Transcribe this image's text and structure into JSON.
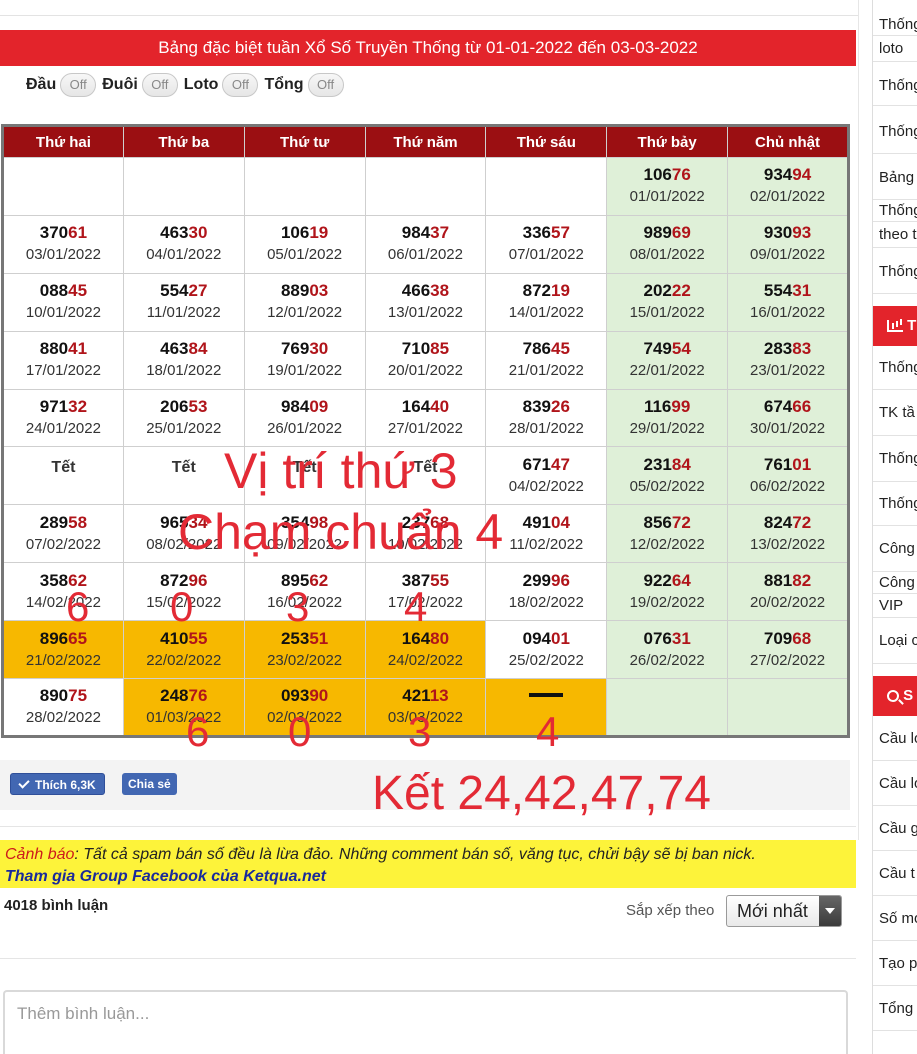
{
  "title": "Bảng đặc biệt tuần Xổ Số Truyền Thống từ 01-01-2022 đến 03-03-2022",
  "toggles": [
    {
      "label": "Đầu",
      "state": "Off"
    },
    {
      "label": "Đuôi",
      "state": "Off"
    },
    {
      "label": "Loto",
      "state": "Off"
    },
    {
      "label": "Tổng",
      "state": "Off"
    }
  ],
  "weekdays": [
    "Thứ hai",
    "Thứ ba",
    "Thứ tư",
    "Thứ năm",
    "Thứ sáu",
    "Thứ bảy",
    "Chủ nhật"
  ],
  "colors": {
    "title_bg": "#e3242b",
    "header_bg": "#9b0f12",
    "weekend_bg": "#dff0d8",
    "highlight_bg": "#f7b800",
    "tail_color": "#b0141a",
    "annotation": "#e32a35"
  },
  "weeks": [
    [
      {
        "empty": true
      },
      {
        "empty": true
      },
      {
        "empty": true
      },
      {
        "empty": true
      },
      {
        "empty": true
      },
      {
        "head": "106",
        "tail": "76",
        "date": "01/01/2022"
      },
      {
        "head": "934",
        "tail": "94",
        "date": "02/01/2022"
      }
    ],
    [
      {
        "head": "370",
        "tail": "61",
        "date": "03/01/2022"
      },
      {
        "head": "463",
        "tail": "30",
        "date": "04/01/2022"
      },
      {
        "head": "106",
        "tail": "19",
        "date": "05/01/2022"
      },
      {
        "head": "984",
        "tail": "37",
        "date": "06/01/2022"
      },
      {
        "head": "336",
        "tail": "57",
        "date": "07/01/2022"
      },
      {
        "head": "989",
        "tail": "69",
        "date": "08/01/2022"
      },
      {
        "head": "930",
        "tail": "93",
        "date": "09/01/2022"
      }
    ],
    [
      {
        "head": "088",
        "tail": "45",
        "date": "10/01/2022"
      },
      {
        "head": "554",
        "tail": "27",
        "date": "11/01/2022"
      },
      {
        "head": "889",
        "tail": "03",
        "date": "12/01/2022"
      },
      {
        "head": "466",
        "tail": "38",
        "date": "13/01/2022"
      },
      {
        "head": "872",
        "tail": "19",
        "date": "14/01/2022"
      },
      {
        "head": "202",
        "tail": "22",
        "date": "15/01/2022"
      },
      {
        "head": "554",
        "tail": "31",
        "date": "16/01/2022"
      }
    ],
    [
      {
        "head": "880",
        "tail": "41",
        "date": "17/01/2022"
      },
      {
        "head": "463",
        "tail": "84",
        "date": "18/01/2022"
      },
      {
        "head": "769",
        "tail": "30",
        "date": "19/01/2022"
      },
      {
        "head": "710",
        "tail": "85",
        "date": "20/01/2022"
      },
      {
        "head": "786",
        "tail": "45",
        "date": "21/01/2022"
      },
      {
        "head": "749",
        "tail": "54",
        "date": "22/01/2022"
      },
      {
        "head": "283",
        "tail": "83",
        "date": "23/01/2022"
      }
    ],
    [
      {
        "head": "971",
        "tail": "32",
        "date": "24/01/2022"
      },
      {
        "head": "206",
        "tail": "53",
        "date": "25/01/2022"
      },
      {
        "head": "984",
        "tail": "09",
        "date": "26/01/2022"
      },
      {
        "head": "164",
        "tail": "40",
        "date": "27/01/2022"
      },
      {
        "head": "839",
        "tail": "26",
        "date": "28/01/2022"
      },
      {
        "head": "116",
        "tail": "99",
        "date": "29/01/2022"
      },
      {
        "head": "674",
        "tail": "66",
        "date": "30/01/2022"
      }
    ],
    [
      {
        "tet": "Tết"
      },
      {
        "tet": "Tết"
      },
      {
        "tet": "Tết"
      },
      {
        "tet": "Tết"
      },
      {
        "head": "671",
        "tail": "47",
        "date": "04/02/2022"
      },
      {
        "head": "231",
        "tail": "84",
        "date": "05/02/2022"
      },
      {
        "head": "761",
        "tail": "01",
        "date": "06/02/2022"
      }
    ],
    [
      {
        "head": "289",
        "tail": "58",
        "date": "07/02/2022"
      },
      {
        "head": "965",
        "tail": "34",
        "date": "08/02/2022"
      },
      {
        "head": "354",
        "tail": "98",
        "date": "09/02/2022"
      },
      {
        "head": "237",
        "tail": "68",
        "date": "10/02/2022"
      },
      {
        "head": "491",
        "tail": "04",
        "date": "11/02/2022"
      },
      {
        "head": "856",
        "tail": "72",
        "date": "12/02/2022"
      },
      {
        "head": "824",
        "tail": "72",
        "date": "13/02/2022"
      }
    ],
    [
      {
        "head": "358",
        "tail": "62",
        "date": "14/02/2022"
      },
      {
        "head": "872",
        "tail": "96",
        "date": "15/02/2022"
      },
      {
        "head": "895",
        "tail": "62",
        "date": "16/02/2022"
      },
      {
        "head": "387",
        "tail": "55",
        "date": "17/02/2022"
      },
      {
        "head": "299",
        "tail": "96",
        "date": "18/02/2022"
      },
      {
        "head": "922",
        "tail": "64",
        "date": "19/02/2022"
      },
      {
        "head": "881",
        "tail": "82",
        "date": "20/02/2022"
      }
    ],
    [
      {
        "head": "896",
        "tail": "65",
        "date": "21/02/2022",
        "highlight": true
      },
      {
        "head": "410",
        "tail": "55",
        "date": "22/02/2022",
        "highlight": true
      },
      {
        "head": "253",
        "tail": "51",
        "date": "23/02/2022",
        "highlight": true
      },
      {
        "head": "164",
        "tail": "80",
        "date": "24/02/2022",
        "highlight": true
      },
      {
        "head": "094",
        "tail": "01",
        "date": "25/02/2022"
      },
      {
        "head": "076",
        "tail": "31",
        "date": "26/02/2022"
      },
      {
        "head": "709",
        "tail": "68",
        "date": "27/02/2022"
      }
    ],
    [
      {
        "head": "890",
        "tail": "75",
        "date": "28/02/2022"
      },
      {
        "head": "248",
        "tail": "76",
        "date": "01/03/2022",
        "highlight": true
      },
      {
        "head": "093",
        "tail": "90",
        "date": "02/03/2022",
        "highlight": true
      },
      {
        "head": "421",
        "tail": "13",
        "date": "03/03/2022",
        "highlight": true
      },
      {
        "pending": true,
        "highlight": true
      },
      {
        "empty": true
      },
      {
        "empty": true
      }
    ]
  ],
  "annotations": {
    "line1": "Vị trí thứ 3",
    "line2": "Chạm chuẩn 4",
    "row_digits": [
      "6",
      "0",
      "3",
      "4"
    ],
    "bottom_digits": [
      "6",
      "0",
      "3",
      "4"
    ],
    "result": "Kết 24,42,47,74"
  },
  "social": {
    "like_label": "Thích 6,3K",
    "share_label": "Chia sẻ"
  },
  "warning": {
    "lead": "Cảnh báo",
    "text": ": Tất cả spam bán số đều là lừa đảo. Những comment bán số, văng tục, chửi bậy sẽ bị ban nick.",
    "link": "Tham gia Group Facebook của Ketqua.net"
  },
  "comments": {
    "count_label": "4018 bình luận",
    "sort_label": "Sắp xếp theo",
    "sort_value": "Mới nhất",
    "input_placeholder": "Thêm bình luận..."
  },
  "sidebar": {
    "items_top": [
      "Thống",
      "loto",
      "Thống",
      "Thống",
      "Bảng",
      "Thống",
      "theo t",
      "Thống"
    ],
    "items_mid": [
      "Thống",
      "TK tầ",
      "Thống",
      "Thống",
      "Công",
      "Công",
      "VIP",
      "Loại c"
    ],
    "items_bottom": [
      "Cầu lo",
      "Cầu lo",
      "Cầu g",
      "Cầu t",
      "Số mơ",
      "Tạo p",
      "Tổng"
    ],
    "head_mid_icon": "bar-chart-icon",
    "head_mid_label": "T",
    "head_bottom_icon": "search-icon",
    "head_bottom_label": "S"
  }
}
